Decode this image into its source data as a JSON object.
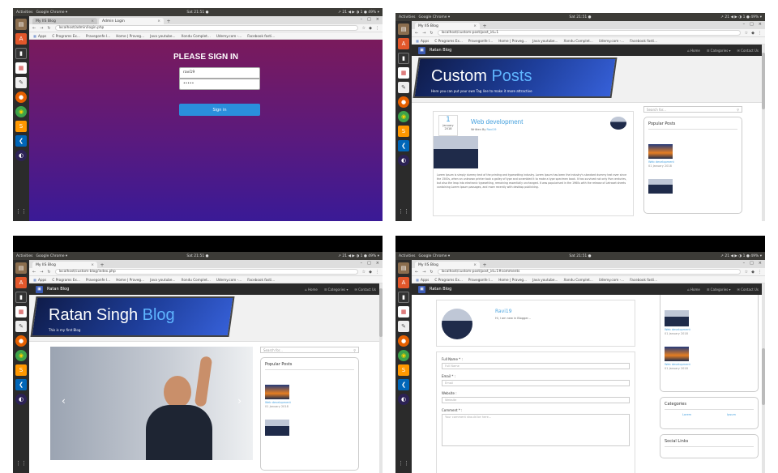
{
  "desktop": {
    "activities": "Activities",
    "app_name": "Google Chrome ▾",
    "clock": "Sat 21:51 ●",
    "tray": "↗ 21 ◀ ▶ ◑ 1 ● 49% ▾"
  },
  "shot1": {
    "tabs": [
      {
        "label": "My IIS Blog",
        "close": "×"
      },
      {
        "label": "Admin Login",
        "close": "×"
      }
    ],
    "url": "localhost/admin/login.php",
    "bookmarks": [
      "Apps",
      "C Programs Ex...",
      "Pravegonfe I...",
      "Home | Praveg...",
      "Java youtube...",
      "Xondu Complet...",
      "Udemy.com -...",
      "Facebook fasti..."
    ],
    "login": {
      "heading": "PLEASE SIGN IN",
      "username_value": "ravi19",
      "password_value": "•••••",
      "button": "Sign in"
    }
  },
  "shot2": {
    "tabs": [
      {
        "label": "My IIS Blog",
        "close": "×"
      }
    ],
    "url": "localhost/custom-post/post_id=1",
    "bookmarks": [
      "Apps",
      "C Programs Ex...",
      "Pravegonfe I...",
      "Home | Praveg...",
      "Java youtube...",
      "Xondu Complet...",
      "Udemy.com -...",
      "Facebook fasti..."
    ],
    "nav": {
      "brand": "Ratan Blog",
      "links": [
        "⌂ Home",
        "☰ Categories ▾",
        "✉ Contact Us"
      ]
    },
    "hero": {
      "title_a": "Custom",
      "title_b": " Posts",
      "subtitle": "Here you can put your own Tag line to make it more attractive"
    },
    "post": {
      "date_day": "1",
      "date_month": "January",
      "date_year": "2018",
      "title": "Web development",
      "author_prefix": "Written By ",
      "author": "Ravi19",
      "body": "Lorem Ipsum is simply dummy text of the printing and typesetting industry. Lorem Ipsum has been the industry's standard dummy text ever since the 1500s, when an unknown printer took a galley of type and scrambled it to make a type specimen book. It has survived not only five centuries, but also the leap into electronic typesetting, remaining essentially unchanged. It was popularised in the 1960s with the release of Letraset sheets containing Lorem Ipsum passages, and more recently with desktop publishing."
    },
    "sidebar": {
      "search_placeholder": "Search for...",
      "popular_heading": "Popular Posts",
      "popular": [
        {
          "title": "Web development",
          "date": "01 January 2018"
        }
      ]
    }
  },
  "shot3": {
    "tabs": [
      {
        "label": "My IIS Blog",
        "close": "×"
      }
    ],
    "url": "localhost/custom-blog/index.php",
    "bookmarks": [
      "Apps",
      "C Programs Ex...",
      "Pravegonfe I...",
      "Home | Praveg...",
      "Java youtube...",
      "Xondu Complet...",
      "Udemy.com -...",
      "Facebook fasti..."
    ],
    "nav": {
      "brand": "Ratan Blog",
      "links": [
        "⌂ Home",
        "☰ Categories ▾",
        "✉ Contact Us"
      ]
    },
    "hero": {
      "title_a": "Ratan Singh",
      "title_b": " Blog",
      "subtitle": "This is my first Blog"
    },
    "carousel": {
      "prev": "‹",
      "next": "›"
    },
    "sidebar": {
      "search_placeholder": "Search for...",
      "popular_heading": "Popular Posts",
      "popular": [
        {
          "title": "Web development",
          "date": "01 January 2018"
        }
      ]
    }
  },
  "shot4": {
    "tabs": [
      {
        "label": "My IIS Blog",
        "close": "×"
      }
    ],
    "url": "localhost/custom-post/post_id=1#comments",
    "bookmarks": [
      "Apps",
      "C Programs Ex...",
      "Pravegonfe I...",
      "Home | Praveg...",
      "Java youtube...",
      "Xondu Complet...",
      "Udemy.com -...",
      "Facebook fasti..."
    ],
    "nav": {
      "brand": "Ratan Blog",
      "links": [
        "⌂ Home",
        "☰ Categories ▾",
        "✉ Contact Us"
      ]
    },
    "author_card": {
      "name": "Ravi19",
      "bio": "Hi, I am new in Blogger..."
    },
    "form": {
      "full_name_label": "Full Name * :",
      "full_name_placeholder": "Full Name",
      "email_label": "Email * :",
      "email_placeholder": "Email",
      "website_label": "Website :",
      "website_placeholder": "Website",
      "comment_label": "Comment * :",
      "comment_placeholder": "Your comment should be here..."
    },
    "sidebar": {
      "popular": [
        {
          "title": "Web development",
          "date": "01 January 2018"
        },
        {
          "title": "Web development",
          "date": "01 January 2018"
        }
      ],
      "categories_heading": "Categories",
      "categories": [
        "Lorem",
        "Ipsum"
      ],
      "social_heading": "Social Links"
    }
  }
}
